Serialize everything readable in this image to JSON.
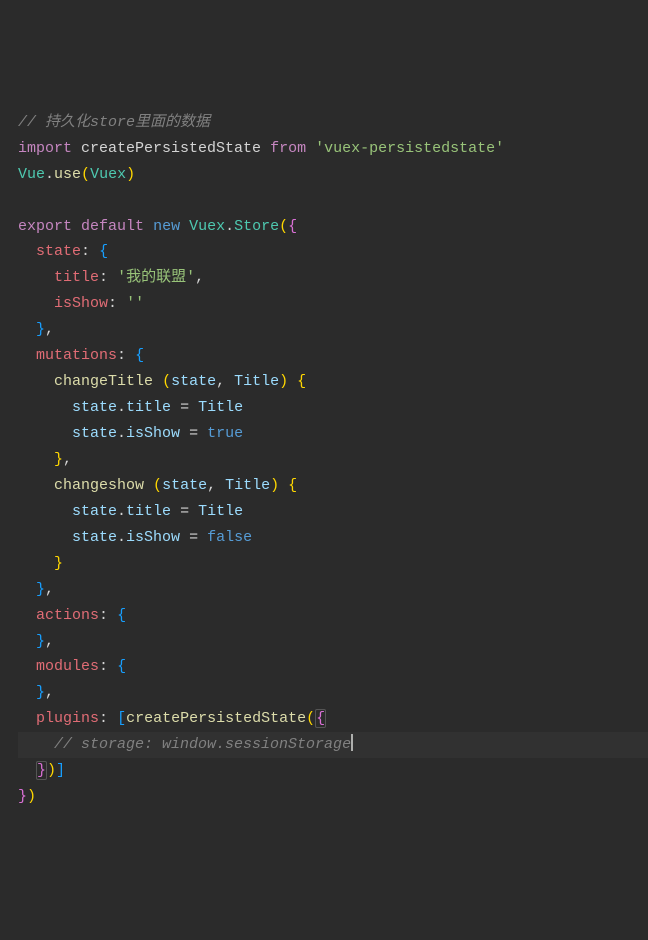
{
  "code": {
    "l1_comment": "// 持久化store里面的数据",
    "l2_import": "import",
    "l2_name": "createPersistedState",
    "l2_from": "from",
    "l2_pkg": "'vuex-persistedstate'",
    "l3_vue": "Vue",
    "l3_use": "use",
    "l3_vuex": "Vuex",
    "l5_export": "export",
    "l5_default": "default",
    "l5_new": "new",
    "l5_store": "Store",
    "state": "state",
    "title_key": "title",
    "title_val": "'我的联盟'",
    "isShow_key": "isShow",
    "isShow_val": "''",
    "mutations": "mutations",
    "changeTitle": "changeTitle",
    "changeshow": "changeshow",
    "state_param": "state",
    "Title_param": "Title",
    "title_member": "title",
    "isShow_member": "isShow",
    "true": "true",
    "false": "false",
    "actions": "actions",
    "modules": "modules",
    "plugins": "plugins",
    "cps": "createPersistedState",
    "storage_comment": "// storage: window.sessionStorage"
  }
}
